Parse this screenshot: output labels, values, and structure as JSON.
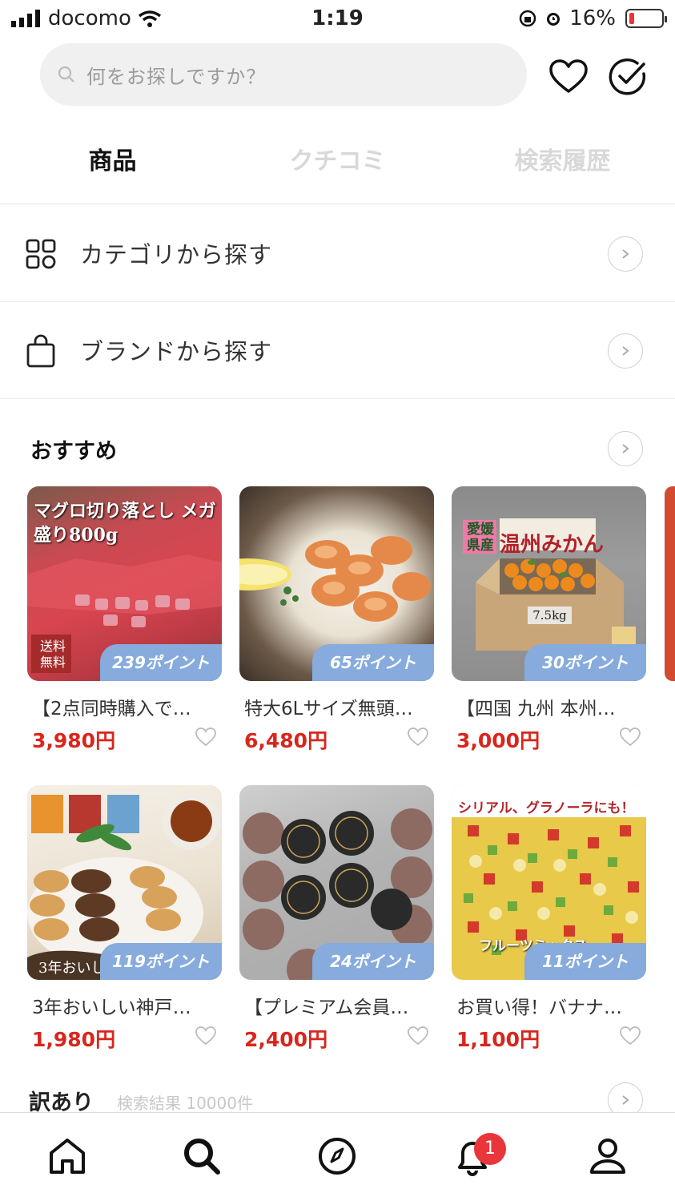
{
  "status_bar": {
    "carrier": "docomo",
    "time": "1:19",
    "battery": "16%"
  },
  "search": {
    "placeholder": "何をお探しですか？"
  },
  "tabs": [
    {
      "label": "商品",
      "active": true
    },
    {
      "label": "クチコミ",
      "active": false
    },
    {
      "label": "検索履歴",
      "active": false
    }
  ],
  "browse": {
    "category_label": "カテゴリから探す",
    "brand_label": "ブランドから探す"
  },
  "recommend": {
    "title": "おすすめ",
    "items": [
      {
        "name": "【2点同時購入で…",
        "price": "3,980円",
        "points": "239ポイント",
        "img_overlay": "マグロ切り落とし メガ盛り800g",
        "badge": "送料 無料"
      },
      {
        "name": "特大6Lサイズ無頭…",
        "price": "6,480円",
        "points": "65ポイント"
      },
      {
        "name": "【四国 九州 本州…",
        "price": "3,000円",
        "points": "30ポイント",
        "img_overlay": "温州みかん",
        "badge": "愛媛 県産",
        "box_label": "7.5kg"
      },
      {
        "name": "3年おいしい神戸…",
        "price": "1,980円",
        "points": "119ポイント",
        "img_overlay": "3年おいしい"
      },
      {
        "name": "【プレミアム会員…",
        "price": "2,400円",
        "points": "24ポイント"
      },
      {
        "name": "お買い得！バナナ…",
        "price": "1,100円",
        "points": "11ポイント",
        "img_overlay": "シリアル、グラノーラにも！",
        "img_overlay2": "フルーツミックス"
      }
    ]
  },
  "wakeari": {
    "title": "訳あり",
    "subtitle": "検索結果 10000件"
  },
  "tabbar": {
    "notification_count": "1"
  },
  "colors": {
    "price": "#d9261c",
    "points_badge": "#86abdc",
    "notification": "#e8363a"
  }
}
